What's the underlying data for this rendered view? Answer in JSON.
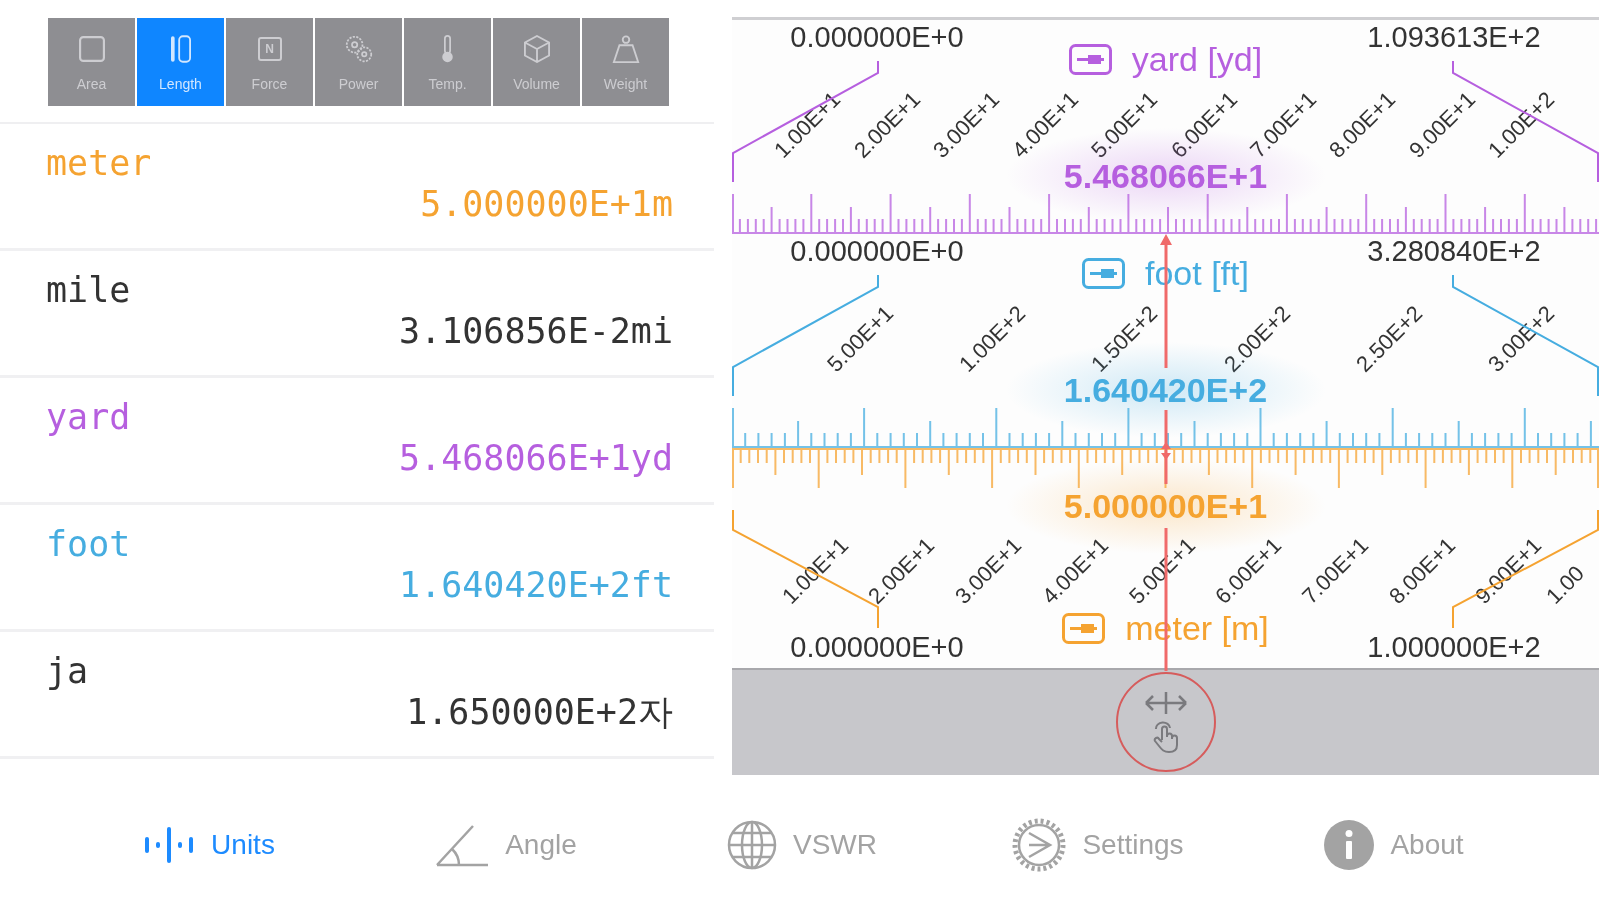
{
  "categories": [
    {
      "label": "Area",
      "selected": false
    },
    {
      "label": "Length",
      "selected": true
    },
    {
      "label": "Force",
      "selected": false,
      "icon_letter": "N"
    },
    {
      "label": "Power",
      "selected": false
    },
    {
      "label": "Temp.",
      "selected": false
    },
    {
      "label": "Volume",
      "selected": false
    },
    {
      "label": "Weight",
      "selected": false
    }
  ],
  "units": [
    {
      "name": "meter",
      "value": "5.000000E+1m",
      "color": "#f5a331"
    },
    {
      "name": "mile",
      "value": "3.106856E-2mi",
      "color": "#333333"
    },
    {
      "name": "yard",
      "value": "5.468066E+1yd",
      "color": "#b65fdf"
    },
    {
      "name": "foot",
      "value": "1.640420E+2ft",
      "color": "#46ade0"
    },
    {
      "name": "ja",
      "value": "1.650000E+2자",
      "color": "#333333"
    }
  ],
  "scales": [
    {
      "kind": "standard",
      "unit": "yard [yd]",
      "color": "#b65fdf",
      "min": "0.000000E+0",
      "max": "1.093613E+2",
      "reading": "5.468066E+1",
      "tick_labels": [
        "1.00E+1",
        "2.00E+1",
        "3.00E+1",
        "4.00E+1",
        "5.00E+1",
        "6.00E+1",
        "7.00E+1",
        "8.00E+1",
        "9.00E+1",
        "1.00E+2"
      ]
    },
    {
      "kind": "standard",
      "unit": "foot [ft]",
      "color": "#46ade0",
      "min": "0.000000E+0",
      "max": "3.280840E+2",
      "reading": "1.640420E+2",
      "tick_labels": [
        "5.00E+1",
        "1.00E+2",
        "1.50E+2",
        "2.00E+2",
        "2.50E+2",
        "3.00E+2"
      ]
    },
    {
      "kind": "flipped",
      "unit": "meter [m]",
      "color": "#f5a331",
      "min": "0.000000E+0",
      "max": "1.000000E+2",
      "reading": "5.000000E+1",
      "tick_labels": [
        "1.00E+1",
        "2.00E+1",
        "3.00E+1",
        "4.00E+1",
        "5.00E+1",
        "6.00E+1",
        "7.00E+1",
        "8.00E+1",
        "9.00E+1",
        "1.00"
      ]
    }
  ],
  "slider": {
    "level": 0.5
  },
  "tab_bar": [
    {
      "label": "Units",
      "selected": true
    },
    {
      "label": "Angle",
      "selected": false
    },
    {
      "label": "VSWR",
      "selected": false
    },
    {
      "label": "Settings",
      "selected": false
    },
    {
      "label": "About",
      "selected": false
    }
  ]
}
